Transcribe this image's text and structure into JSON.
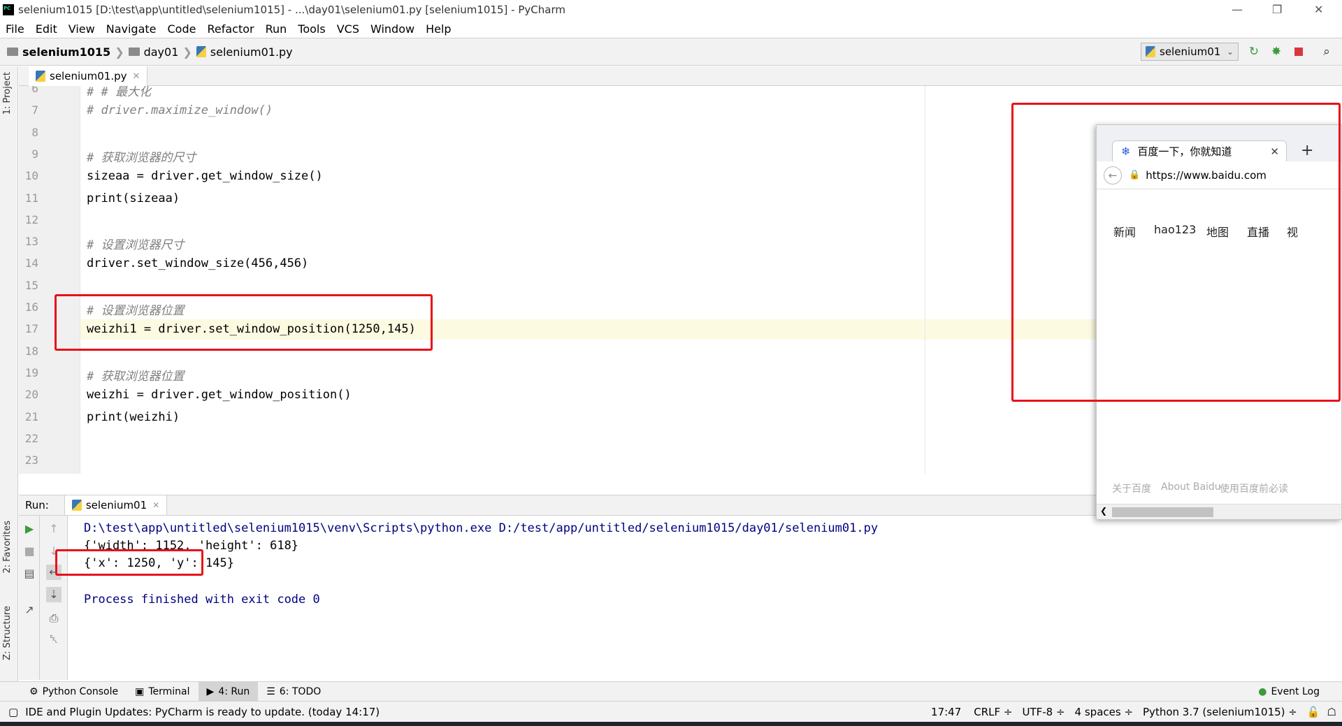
{
  "window": {
    "title": "selenium1015 [D:\\test\\app\\untitled\\selenium1015] - ...\\day01\\selenium01.py [selenium1015] - PyCharm",
    "controls": {
      "minimize": "—",
      "restore": "❐",
      "close": "✕"
    }
  },
  "menu": [
    "File",
    "Edit",
    "View",
    "Navigate",
    "Code",
    "Refactor",
    "Run",
    "Tools",
    "VCS",
    "Window",
    "Help"
  ],
  "breadcrumb": {
    "project": "selenium1015",
    "folder": "day01",
    "file": "selenium01.py"
  },
  "run_config": {
    "label": "selenium01",
    "chevron": "⌄"
  },
  "toolbar_icons": [
    "rerun-icon",
    "debug-icon",
    "stop-icon",
    "search-icon"
  ],
  "tool_windows_left": {
    "project": "1: Project",
    "favorites": "2: Favorites",
    "structure": "Z: Structure"
  },
  "editor": {
    "tab_label": "selenium01.py",
    "lines": [
      {
        "n": "6",
        "text": "# # 最大化",
        "kind": "comment"
      },
      {
        "n": "7",
        "text": "# driver.maximize_window()",
        "kind": "comment"
      },
      {
        "n": "8",
        "text": "",
        "kind": "code"
      },
      {
        "n": "9",
        "text": "# 获取浏览器的尺寸",
        "kind": "comment"
      },
      {
        "n": "10",
        "text": "sizeaa = driver.get_window_size()",
        "kind": "code"
      },
      {
        "n": "11",
        "text": "print(sizeaa)",
        "kind": "code"
      },
      {
        "n": "12",
        "text": "",
        "kind": "code"
      },
      {
        "n": "13",
        "text": "# 设置浏览器尺寸",
        "kind": "comment"
      },
      {
        "n": "14",
        "text": "driver.set_window_size(456,456)",
        "kind": "code"
      },
      {
        "n": "15",
        "text": "",
        "kind": "code"
      },
      {
        "n": "16",
        "text": "# 设置浏览器位置",
        "kind": "comment"
      },
      {
        "n": "17",
        "text": "weizhi1 = driver.set_window_position(1250,145)",
        "kind": "code"
      },
      {
        "n": "18",
        "text": "",
        "kind": "code"
      },
      {
        "n": "19",
        "text": "# 获取浏览器位置",
        "kind": "comment"
      },
      {
        "n": "20",
        "text": "weizhi = driver.get_window_position()",
        "kind": "code"
      },
      {
        "n": "21",
        "text": "print(weizhi)",
        "kind": "code"
      },
      {
        "n": "22",
        "text": "",
        "kind": "code"
      },
      {
        "n": "23",
        "text": "",
        "kind": "code"
      }
    ]
  },
  "run_panel": {
    "label": "Run:",
    "tab_label": "selenium01",
    "output": [
      "D:\\test\\app\\untitled\\selenium1015\\venv\\Scripts\\python.exe D:/test/app/untitled/selenium1015/day01/selenium01.py",
      "{'width': 1152, 'height': 618}",
      "{'x': 1250, 'y': 145}",
      "",
      "Process finished with exit code 0"
    ]
  },
  "bottom_tabs": [
    "Python Console",
    "Terminal",
    "4: Run",
    "6: TODO"
  ],
  "event_log": "Event Log",
  "status": {
    "message": "IDE and Plugin Updates: PyCharm is ready to update. (today 14:17)",
    "position": "17:47",
    "line_sep": "CRLF ÷",
    "encoding": "UTF-8 ÷",
    "indent": "4 spaces ÷",
    "interpreter": "Python 3.7 (selenium1015) ÷"
  },
  "browser": {
    "tab_title": "百度一下，你就知道",
    "close": "✕",
    "new_tab": "+",
    "url": "https://www.baidu.com",
    "nav_links": [
      "新闻",
      "hao123",
      "地图",
      "直播",
      "视"
    ],
    "footer_links": [
      "关于百度",
      "About Baidu",
      "使用百度前必读"
    ]
  },
  "colors": {
    "highlight_box": "#e8121a",
    "comment": "#808080",
    "number": "#1750eb",
    "builtin": "#000080",
    "output_blue": "#000080"
  }
}
